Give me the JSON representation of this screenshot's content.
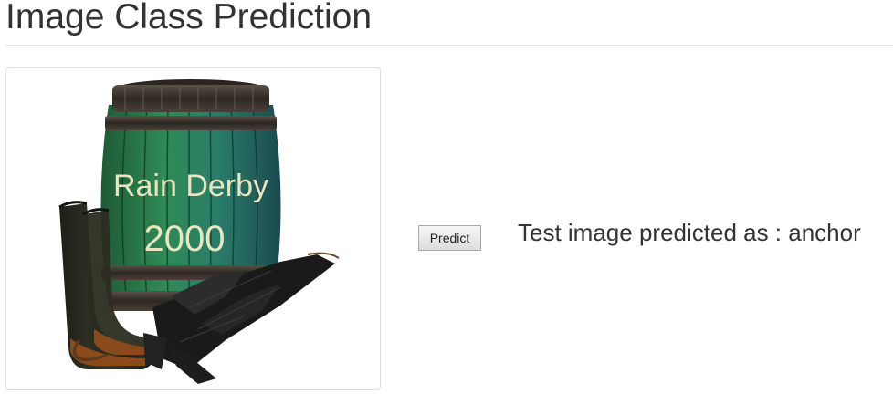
{
  "page": {
    "title": "Image Class Prediction"
  },
  "image": {
    "barrel_text_line1": "Rain Derby",
    "barrel_text_line2": "2000"
  },
  "actions": {
    "predict_label": "Predict"
  },
  "result": {
    "prefix": "Test image predicted as : ",
    "predicted_class": "anchor"
  }
}
